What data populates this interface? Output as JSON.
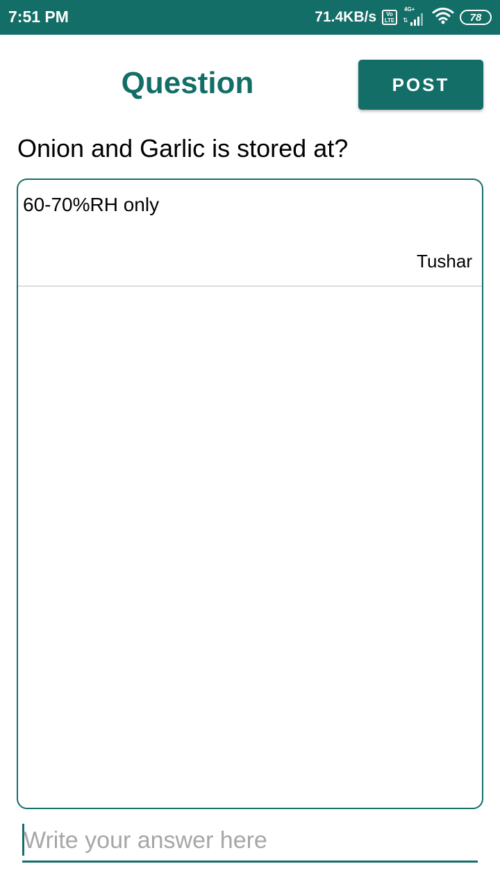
{
  "status_bar": {
    "time": "7:51 PM",
    "net_speed": "71.4KB/s",
    "volte_top": "Vo",
    "volte_bottom": "LTE",
    "network_type": "4G+",
    "battery_level": "78",
    "background_color": "#126e67"
  },
  "header": {
    "title": "Question",
    "post_label": "POST"
  },
  "question": {
    "text": "Onion and Garlic is stored at?"
  },
  "answers": [
    {
      "text": "60-70%RH only",
      "author": "Tushar"
    }
  ],
  "answer_input": {
    "placeholder": "Write your answer here",
    "value": ""
  },
  "colors": {
    "accent": "#126e67",
    "placeholder": "#a6a6a6",
    "divider": "#dddddd"
  },
  "icons": [
    "wifi-icon",
    "signal-icon",
    "battery-icon",
    "volte-icon"
  ]
}
